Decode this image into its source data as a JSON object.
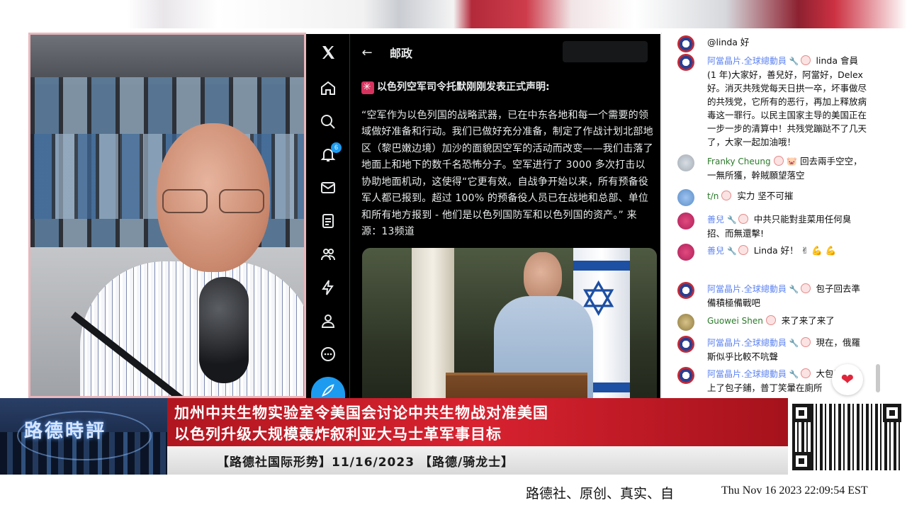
{
  "twitter": {
    "header_title": "邮政",
    "notification_count": "6",
    "tweet_heading": "以色列空军司令托默刚刚发表正式声明:",
    "tweet_body": "“空军作为以色列国的战略武器，已在中东各地和每一个需要的领域做好准备和行动。我们已做好充分准备，制定了作战计划北部地区（黎巴嫩边境）加沙的面貌因空军的活动而改变——我们击落了地面上和地下的数千名恐怖分子。空军进行了 3000 多次打击以协助地面机动，这使得“它更有效。自战争开始以来，所有预备役军人都已报到。超过 100% 的预备役人员已在战地和总部、单位和所有地方报到 - 他们是以色列国防军和以色列国的资产。” 来源：13频道",
    "rail_icons": [
      "x-logo-icon",
      "home-icon",
      "search-icon",
      "bell-icon",
      "mail-icon",
      "list-icon",
      "people-icon",
      "lightning-icon",
      "profile-icon",
      "more-icon"
    ]
  },
  "chat": {
    "messages": [
      {
        "author": "",
        "text": "@linda 好",
        "avatar": "flag"
      },
      {
        "author": "阿當晶片.全球總動員",
        "text": "linda 會員 (1 年)大家好，善兒好，阿當好，Delex好。消灭共残党每天日拱一卒，坏事做尽的共残党，它所有的恶行，再加上释放病毒这一罪行。以民主国家主导的美国正在一步一步的清算中！共残党蹦跶不了几天了，大家一起加油哦！",
        "avatar": "flag"
      },
      {
        "author": "Franky Cheung",
        "text": "回去兩手空空，一無所獲，幹賊願望落空",
        "avatar": "grey"
      },
      {
        "author": "t/n",
        "text": "实力 坚不可摧",
        "avatar": "blue"
      },
      {
        "author": "善兒",
        "text": "中共只能對韭菜用任何臭招、而無還擊!",
        "avatar": "pink"
      },
      {
        "author": "善兒",
        "text": "Linda 好！ ✌ 💪 💪",
        "avatar": "pink"
      },
      {
        "author": "阿當晶片.全球總動員",
        "text": "包子回去準備積極備戰吧",
        "avatar": "flag"
      },
      {
        "author": "Guowei Shen",
        "text": "来了来了来了",
        "avatar": "gold"
      },
      {
        "author": "阿當晶片.全球總動員",
        "text": "現在，俄羅斯似乎比較不吭聲",
        "avatar": "flag"
      },
      {
        "author": "阿當晶片.全球總動員",
        "text": "大包子已經上了包子鋪，普丁笑暈在廁所",
        "avatar": "flag"
      }
    ]
  },
  "banner": {
    "logo_text": "路德時評",
    "headline_1": "加州中共生物实验室令美国会讨论中共生物战对准美国",
    "headline_2": "以色列升级大规模轰炸叙利亚大马士革军事目标",
    "subline": "【路德社国际形势】11/16/2023 【路德/骑龙士】"
  },
  "ticker": {
    "text": "路德社、原创、真实、自",
    "clock": "Thu Nov 16 2023 22:09:54 EST"
  },
  "colors": {
    "x_accent": "#1d9bf0",
    "banner_red": "#d82230",
    "chat_mod": "#5e84f1",
    "chat_member": "#2b7a2b"
  }
}
